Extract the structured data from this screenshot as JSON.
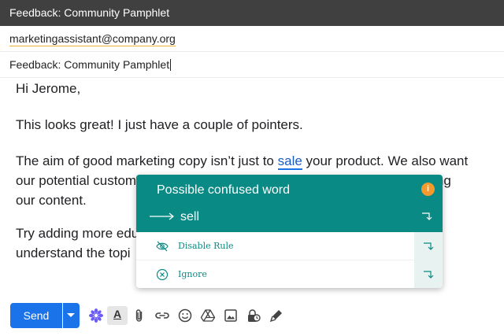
{
  "window": {
    "title": "Feedback: Community Pamphlet"
  },
  "compose": {
    "to": "marketingassistant@company.org",
    "subject": "Feedback: Community Pamphlet"
  },
  "body": {
    "greeting": "Hi Jerome,",
    "para1": "This looks great! I just have a couple of pointers.",
    "para2_before": "The aim of good marketing copy isn’t just to ",
    "para2_flagged": "sale",
    "para2_after_line1": " your product. We also want",
    "para2_line2_start": "our potential custom",
    "para2_line2_end": "reading",
    "para2_line3": "our content.",
    "para3_line1": "Try adding more edu",
    "para3_line2": "understand the topi"
  },
  "suggestion_popup": {
    "title": "Possible confused word",
    "info_icon": "info-icon",
    "suggestion": "sell",
    "actions": [
      {
        "label": "Disable Rule",
        "icon": "eye-off-icon"
      },
      {
        "label": "Ignore",
        "icon": "cancel-circle-icon"
      }
    ],
    "colors": {
      "header": "#0a8a84",
      "info": "#f29a2e",
      "action_text": "#0a8a84"
    }
  },
  "toolbar": {
    "send_label": "Send",
    "format_label": "A",
    "icons": [
      "send-options-icon",
      "extension-icon",
      "format-text-icon",
      "attach-icon",
      "link-icon",
      "emoji-icon",
      "drive-icon",
      "image-icon",
      "confidential-icon",
      "signature-icon"
    ],
    "colors": {
      "send": "#1a73e8",
      "extension": "#6b5cf6"
    }
  }
}
